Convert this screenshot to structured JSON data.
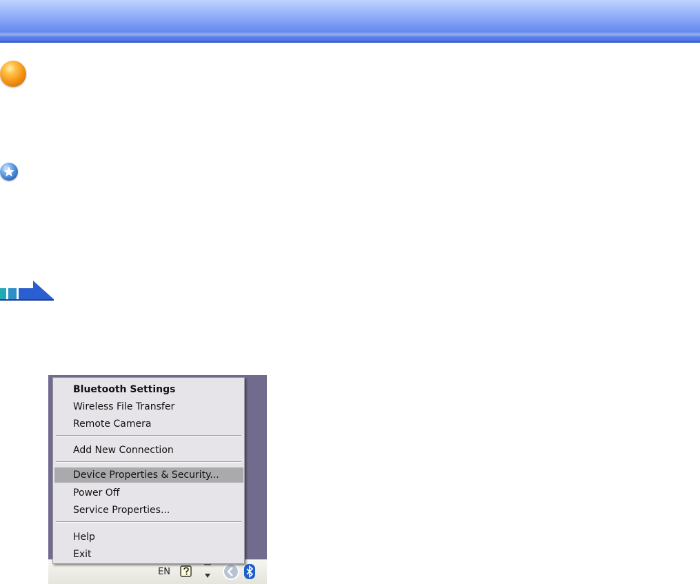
{
  "menu": {
    "items": [
      {
        "label": "Bluetooth Settings",
        "bold": true
      },
      {
        "label": "Wireless File Transfer"
      },
      {
        "label": "Remote Camera"
      },
      {
        "label": "Add New Connection"
      },
      {
        "label": "Device Properties & Security...",
        "selected": true
      },
      {
        "label": "Power Off"
      },
      {
        "label": "Service Properties..."
      },
      {
        "label": "Help"
      },
      {
        "label": "Exit"
      }
    ]
  },
  "taskbar": {
    "language": "EN",
    "icons": [
      "help-icon",
      "network-arrows-icon",
      "show-hidden-icons-chevron",
      "bluetooth-icon"
    ]
  },
  "page_icons": [
    "orange-bullet-icon",
    "blue-star-icon",
    "next-arrow-icon"
  ],
  "colors": {
    "banner_blue": "#6c8ef0",
    "menu_background": "#e6e4e8",
    "menu_selection": "#aaa9ac",
    "desktop_background": "#716c8d"
  }
}
